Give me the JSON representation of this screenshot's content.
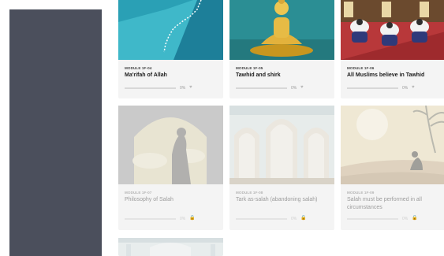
{
  "cards": [
    {
      "code": "MODULE 1F-04",
      "title": "Ma'rifah of Allah",
      "percent": "0%",
      "progress": 0,
      "locked": false,
      "image_icon": "mountain-path-icon"
    },
    {
      "code": "MODULE 1F-05",
      "title": "Tawhid and shirk",
      "percent": "0%",
      "progress": 0,
      "locked": false,
      "image_icon": "buddha-statue-icon"
    },
    {
      "code": "MODULE 1F-06",
      "title": "All Muslims believe in Tawhid",
      "percent": "0%",
      "progress": 0,
      "locked": false,
      "image_icon": "people-praying-icon"
    },
    {
      "code": "MODULE 1F-07",
      "title": "Philosophy of Salah",
      "percent": "0%",
      "progress": 0,
      "locked": true,
      "image_icon": "praying-woman-window-icon"
    },
    {
      "code": "MODULE 1F-08",
      "title": "Tark as-salah (abandoning salah)",
      "percent": "0%",
      "progress": 0,
      "locked": true,
      "image_icon": "mosque-arches-icon"
    },
    {
      "code": "MODULE 1F-09",
      "title": "Salah must be performed in all circumstances",
      "percent": "0%",
      "progress": 0,
      "locked": true,
      "image_icon": "desert-prayer-icon"
    }
  ],
  "heart_glyph": "♥",
  "lock_glyph": "🔒",
  "colors": {
    "sidebar": "#4b4f5c",
    "card_bg": "#f4f4f4"
  }
}
